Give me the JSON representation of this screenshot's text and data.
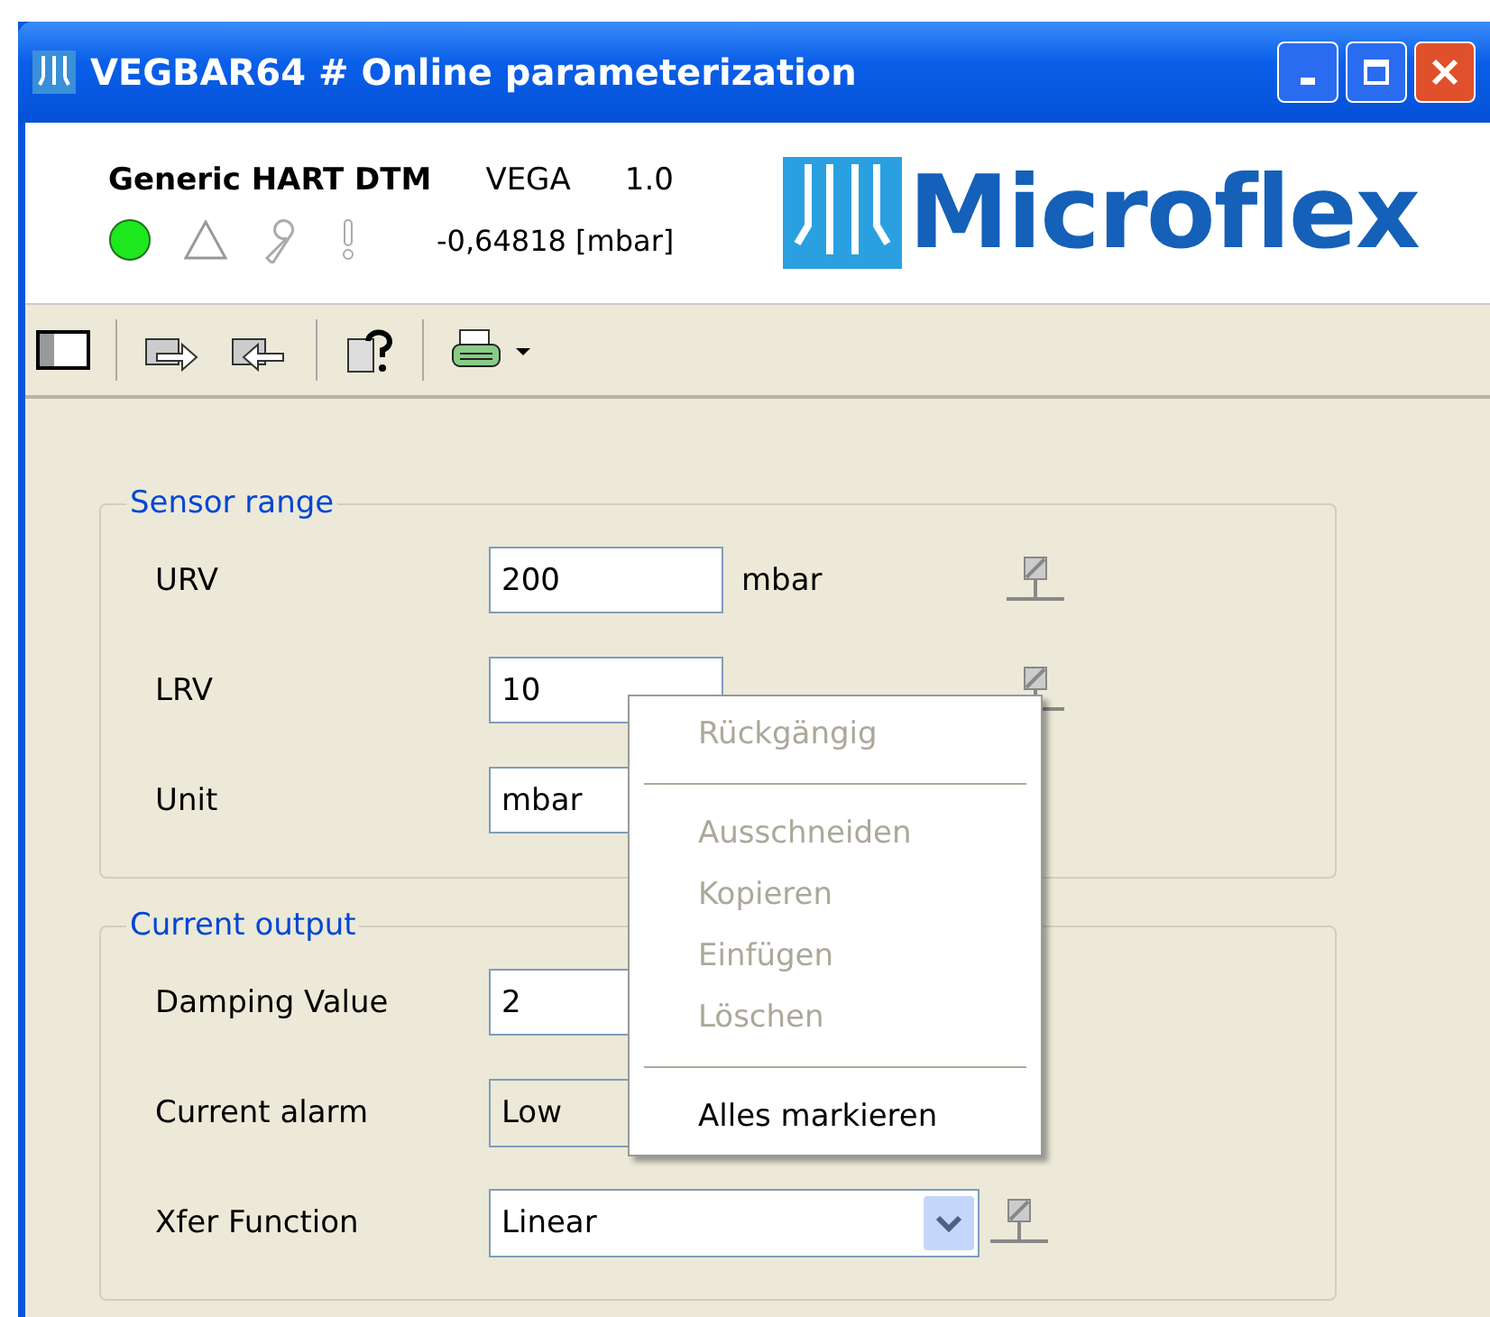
{
  "window": {
    "title": "VEGBAR64 # Online parameterization"
  },
  "header": {
    "dtm": "Generic HART DTM",
    "vendor": "VEGA",
    "version": "1.0",
    "reading": "-0,64818 [mbar]",
    "logo": "Microflex"
  },
  "groups": [
    {
      "title": "Sensor range",
      "rows": [
        {
          "label": "URV",
          "kind": "input",
          "value": "200",
          "unit": "mbar",
          "device_icon": true
        },
        {
          "label": "LRV",
          "kind": "input",
          "value": "10",
          "device_icon": true
        },
        {
          "label": "Unit",
          "kind": "input",
          "value": "mbar",
          "device_icon": false
        }
      ]
    },
    {
      "title": "Current output",
      "rows": [
        {
          "label": "Damping Value",
          "kind": "input",
          "value": "2",
          "device_icon": false
        },
        {
          "label": "Current alarm",
          "kind": "readonly_combo",
          "value": "Low",
          "device_icon": false
        },
        {
          "label": "Xfer Function",
          "kind": "combo",
          "value": "Linear",
          "device_icon": true
        }
      ]
    }
  ],
  "context_menu": {
    "items": [
      {
        "kind": "item",
        "label": "Rückgängig",
        "disabled": true
      },
      {
        "kind": "separator"
      },
      {
        "kind": "item",
        "label": "Ausschneiden",
        "disabled": true
      },
      {
        "kind": "item",
        "label": "Kopieren",
        "disabled": true
      },
      {
        "kind": "item",
        "label": "Einfügen",
        "disabled": true
      },
      {
        "kind": "item",
        "label": "Löschen",
        "disabled": true
      },
      {
        "kind": "separator"
      },
      {
        "kind": "item",
        "label": "Alles markieren",
        "disabled": false
      }
    ]
  }
}
